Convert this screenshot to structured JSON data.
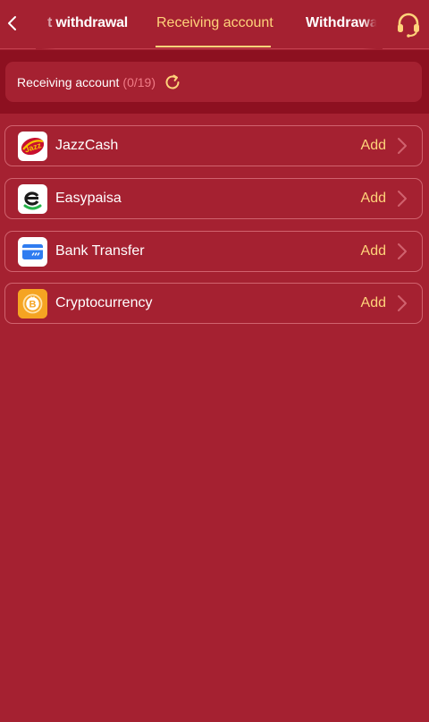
{
  "header": {
    "tabs": [
      {
        "label": "t withdrawal"
      },
      {
        "label": "Receiving account"
      },
      {
        "label": "Withdrawal r"
      }
    ],
    "active_tab_color": "#ffd37a"
  },
  "summary": {
    "label": "Receiving account",
    "count": "(0/19)"
  },
  "methods": [
    {
      "name": "JazzCash",
      "action": "Add",
      "icon": "jazzcash-logo"
    },
    {
      "name": "Easypaisa",
      "action": "Add",
      "icon": "easypaisa-logo"
    },
    {
      "name": "Bank Transfer",
      "action": "Add",
      "icon": "bank-card-icon"
    },
    {
      "name": "Cryptocurrency",
      "action": "Add",
      "icon": "bitcoin-icon"
    }
  ],
  "colors": {
    "background": "#a52131",
    "header_band": "#8d1020",
    "accent": "#ffd37a",
    "count": "#f07b86",
    "row_border": "#d0626e"
  }
}
